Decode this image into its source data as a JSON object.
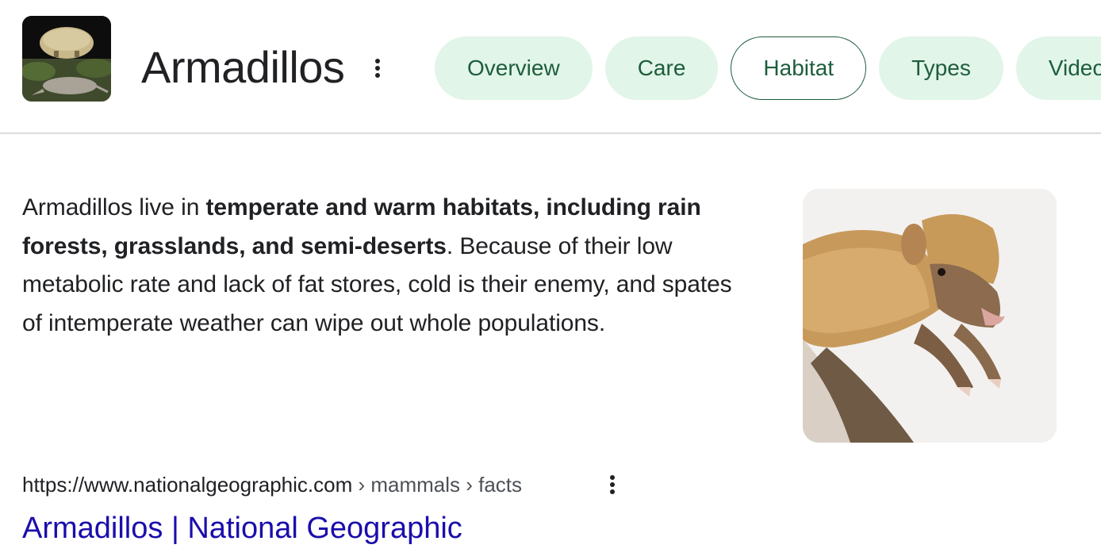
{
  "entity": {
    "title": "Armadillos"
  },
  "tabs": [
    {
      "label": "Overview",
      "active": false
    },
    {
      "label": "Care",
      "active": false
    },
    {
      "label": "Habitat",
      "active": true
    },
    {
      "label": "Types",
      "active": false
    },
    {
      "label": "Videos",
      "active": false
    }
  ],
  "snippet": {
    "prefix": "Armadillos live in ",
    "highlight": "temperate and warm habitats, including rain forests, grasslands, and semi-deserts",
    "suffix": ". Because of their low metabolic rate and lack of fat stores, cold is their enemy, and spates of intemperate weather can wipe out whole populations."
  },
  "source": {
    "domain": "https://www.nationalgeographic.com",
    "breadcrumbs": " › mammals › facts",
    "title": "Armadillos | National Geographic"
  },
  "icons": {
    "title_menu": "more-vert-icon",
    "source_menu": "more-vert-icon"
  },
  "colors": {
    "chip_bg": "#e1f5e8",
    "chip_text": "#1e5d3c",
    "link": "#1a0dab",
    "text": "#202124",
    "muted": "#4d5156",
    "divider": "#dadce0"
  }
}
